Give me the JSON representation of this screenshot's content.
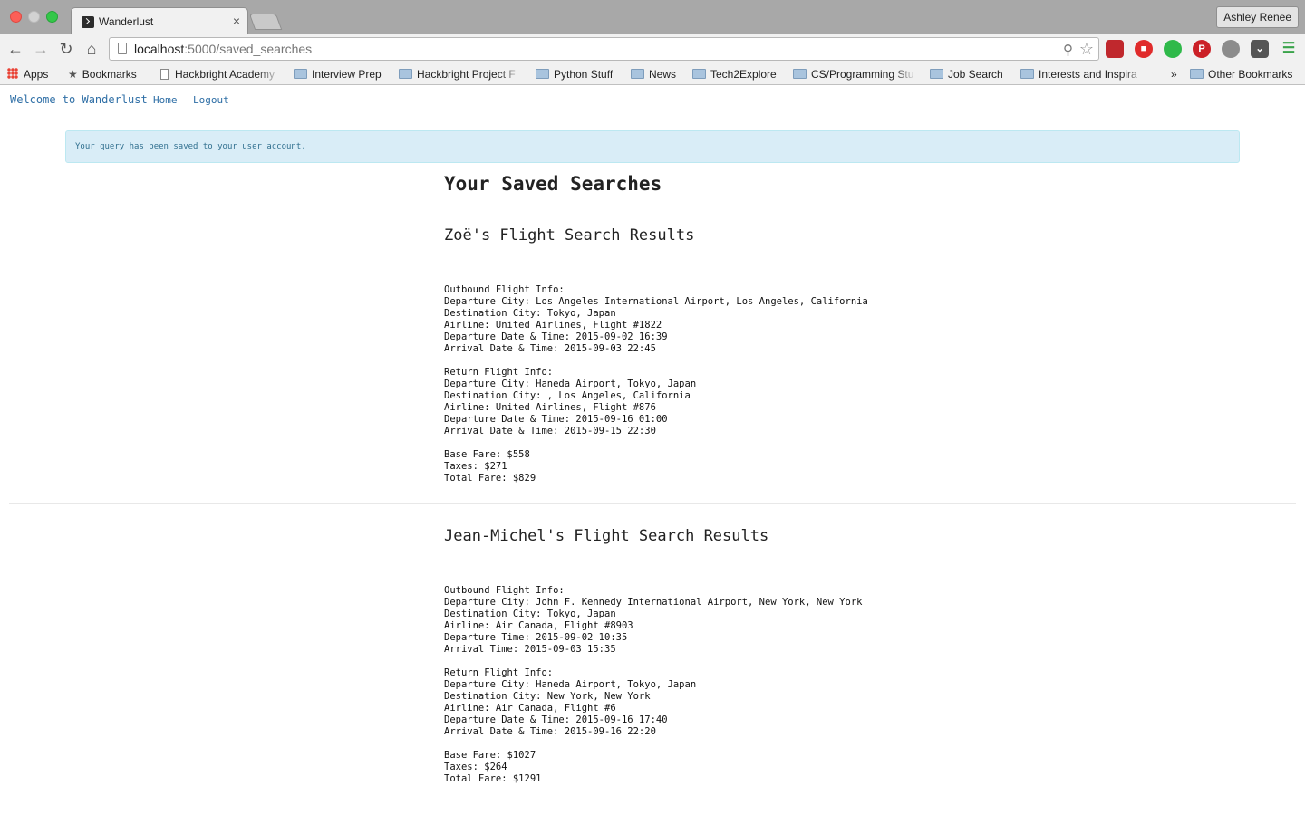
{
  "browser": {
    "tab_title": "Wanderlust",
    "tab_close": "×",
    "profile_name": "Ashley Renee",
    "url_host": "localhost",
    "url_rest": ":5000/saved_searches",
    "bookmarks": [
      {
        "label": "Apps",
        "icon": "apps-icon"
      },
      {
        "label": "Bookmarks",
        "icon": "star-icon"
      },
      {
        "label": "Hackbright Academy",
        "icon": "page-icon"
      },
      {
        "label": "Interview Prep",
        "icon": "folder-icon"
      },
      {
        "label": "Hackbright Project F",
        "icon": "folder-icon"
      },
      {
        "label": "Python Stuff",
        "icon": "folder-icon"
      },
      {
        "label": "News",
        "icon": "folder-icon"
      },
      {
        "label": "Tech2Explore",
        "icon": "folder-icon"
      },
      {
        "label": "CS/Programming Stu",
        "icon": "folder-icon"
      },
      {
        "label": "Job Search",
        "icon": "folder-icon"
      },
      {
        "label": "Interests and Inspira",
        "icon": "folder-icon"
      },
      {
        "label": "Other Bookmarks",
        "icon": "folder-icon"
      }
    ],
    "overflow_chevron": "»"
  },
  "nav": {
    "brand": "Welcome to Wanderlust",
    "home": "Home",
    "logout": "Logout"
  },
  "alert": {
    "message": "Your query has been saved to your user account."
  },
  "page": {
    "title": "Your Saved Searches"
  },
  "results": [
    {
      "heading": "Zoë's Flight Search Results",
      "outbound": {
        "label": "Outbound Flight Info:",
        "departure_city": "Departure City: Los Angeles International Airport, Los Angeles, California",
        "destination_city": "Destination City: Tokyo, Japan",
        "airline": "Airline: United Airlines, Flight #1822",
        "departure": "Departure Date & Time: 2015-09-02 16:39",
        "arrival": "Arrival Date & Time: 2015-09-03 22:45"
      },
      "return": {
        "label": "Return Flight Info:",
        "departure_city": "Departure City: Haneda Airport, Tokyo, Japan",
        "destination_city": "Destination City: , Los Angeles, California",
        "airline": "Airline: United Airlines, Flight #876",
        "departure": "Departure Date & Time: 2015-09-16 01:00",
        "arrival": "Arrival Date & Time: 2015-09-15 22:30"
      },
      "fare": {
        "base": "Base Fare: $558",
        "taxes": "Taxes: $271",
        "total": "Total Fare: $829"
      }
    },
    {
      "heading": "Jean-Michel's Flight Search Results",
      "outbound": {
        "label": "Outbound Flight Info:",
        "departure_city": "Departure City: John F. Kennedy International Airport, New York, New York",
        "destination_city": "Destination City: Tokyo, Japan",
        "airline": "Airline: Air Canada, Flight #8903",
        "departure": "Departure Time: 2015-09-02 10:35",
        "arrival": "Arrival Time: 2015-09-03 15:35"
      },
      "return": {
        "label": "Return Flight Info:",
        "departure_city": "Departure City: Haneda Airport, Tokyo, Japan",
        "destination_city": "Destination City: New York, New York",
        "airline": "Airline: Air Canada, Flight #6",
        "departure": "Departure Date & Time: 2015-09-16 17:40",
        "arrival": "Arrival Date & Time: 2015-09-16 22:20"
      },
      "fare": {
        "base": "Base Fare: $1027",
        "taxes": "Taxes: $264",
        "total": "Total Fare: $1291"
      }
    }
  ]
}
